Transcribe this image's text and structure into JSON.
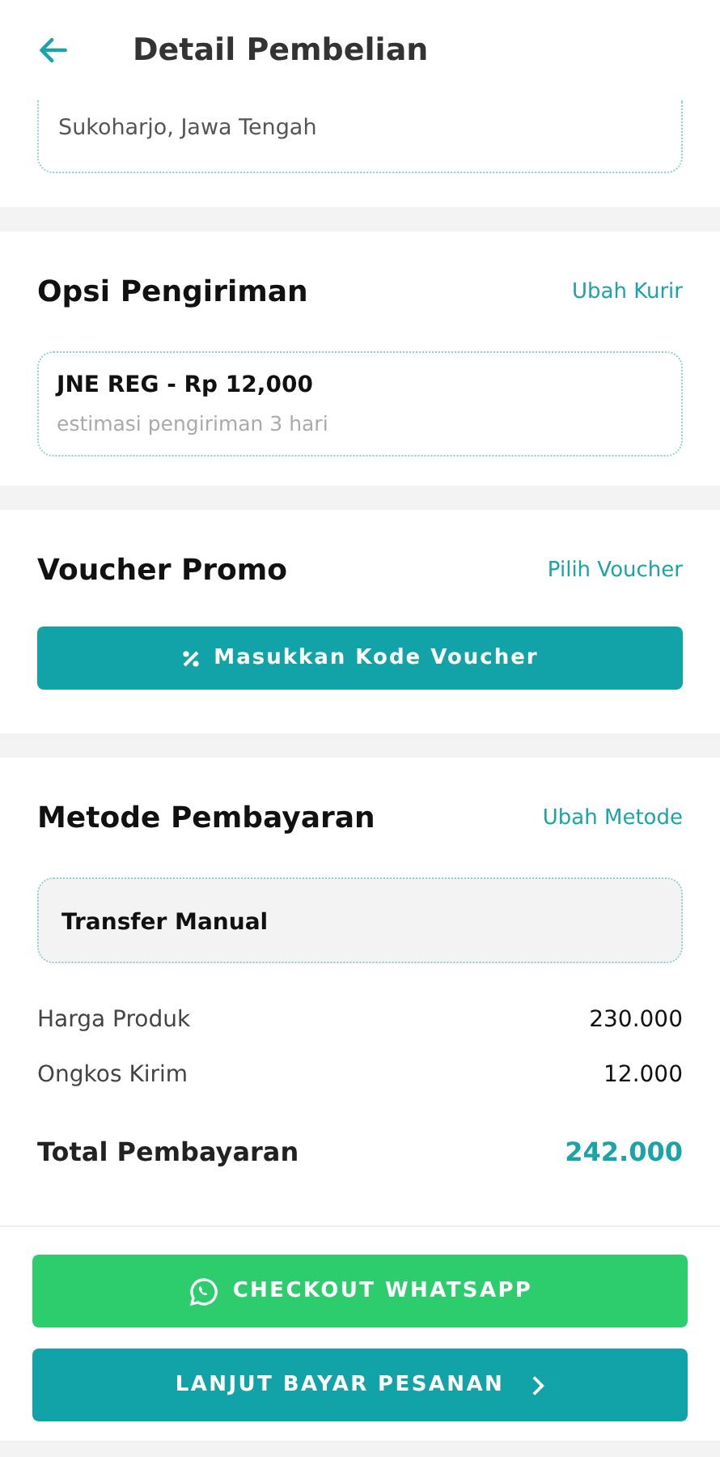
{
  "header": {
    "title": "Detail Pembelian"
  },
  "address": {
    "visible_line": "Sukoharjo, Jawa Tengah"
  },
  "shipping": {
    "title": "Opsi Pengiriman",
    "action": "Ubah Kurir",
    "courier": "JNE REG - Rp 12,000",
    "estimate": "estimasi pengiriman 3 hari"
  },
  "voucher": {
    "title": "Voucher Promo",
    "action": "Pilih Voucher",
    "button": "Masukkan Kode Voucher"
  },
  "payment": {
    "title": "Metode Pembayaran",
    "action": "Ubah Metode",
    "method": "Transfer Manual",
    "lines": [
      {
        "label": "Harga Produk",
        "value": "230.000"
      },
      {
        "label": "Ongkos Kirim",
        "value": "12.000"
      }
    ],
    "total": {
      "label": "Total Pembayaran",
      "value": "242.000"
    }
  },
  "buttons": [
    {
      "kind": "whatsapp",
      "label": "CHECKOUT WHATSAPP"
    },
    {
      "kind": "next",
      "label": "LANJUT BAYAR PESANAN"
    }
  ]
}
